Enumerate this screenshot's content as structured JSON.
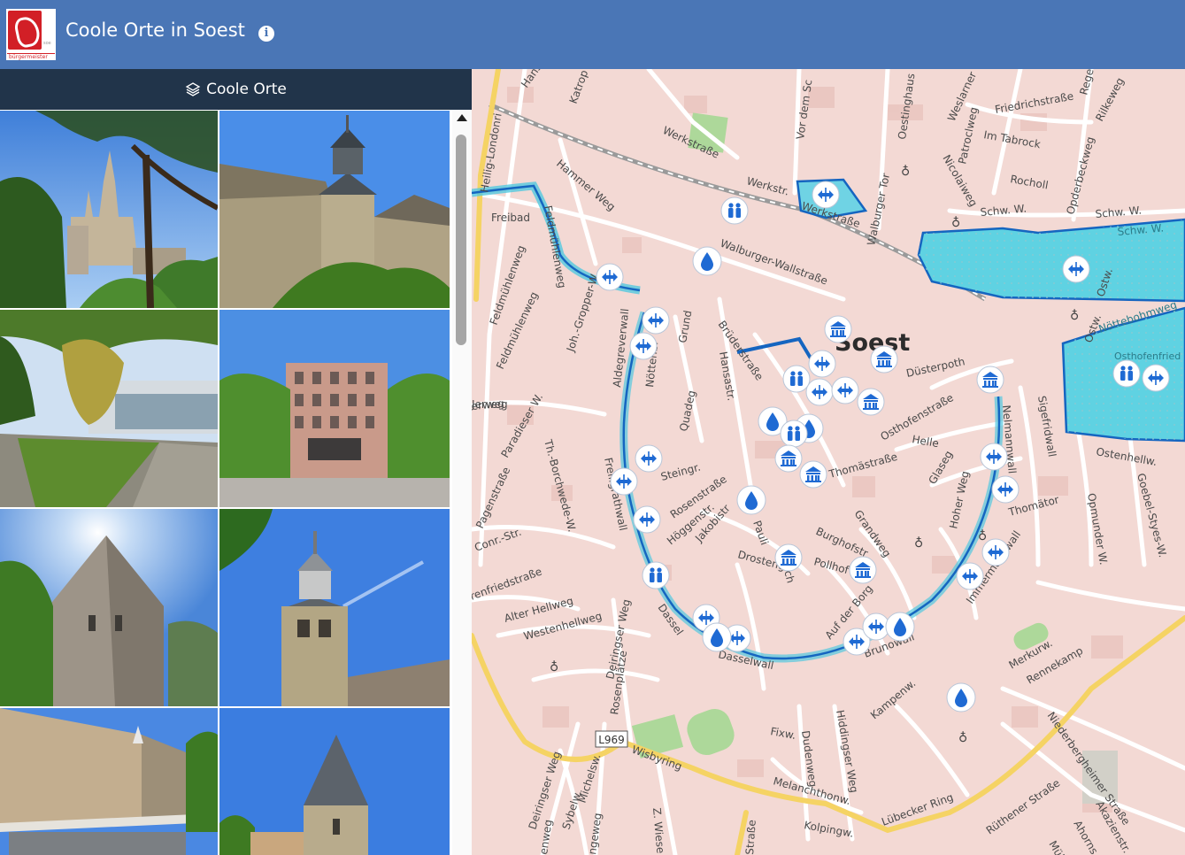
{
  "header": {
    "logo_text": "bürgermeister",
    "logo_side": "soe",
    "title": "Coole Orte in Soest",
    "info_icon": "info-icon"
  },
  "panel": {
    "tab_label": "Coole Orte",
    "tab_icon": "layers-icon"
  },
  "map": {
    "city_label": "Soest",
    "road_badge": "L969",
    "streets": [
      "Hansa",
      "Katrop",
      "Werkstraße",
      "Werkstr.",
      "Werkstraße",
      "Hammer Weg",
      "Feldmühlenweg",
      "Feldmühlenweg",
      "Joh.-Gropper-W.",
      "Vor dem Sc",
      "Oestinghaus",
      "Weslarner",
      "Friedrichstraße",
      "Im Tabrock",
      "Patroclweg",
      "Nicolaiweg",
      "Rocholl",
      "Regenh",
      "Opderbeckweg",
      "Rilkeweg",
      "Schw. W.",
      "Schw. W.",
      "Schw. W.",
      "Walburger Tor",
      "Walburger-Wallstraße",
      "Grund",
      "Brüderstraße",
      "Hansastr.",
      "Aldegreverwall",
      "Nöttenbr",
      "Quadeg",
      "Freiligrathwall",
      "Paradieser W.",
      "Th.-Borchwede-W.",
      "Pagenstraße",
      "Conr.-Str.",
      "erweg",
      "Steingr.",
      "Rosenstraße",
      "Höggenstr.",
      "Jakobistr",
      "Pauli",
      "Drosteng.",
      "Ulrich",
      "Burghofstr",
      "Grandweg",
      "Pollhof",
      "Auf der Borg",
      "Brunowall",
      "Thomästraße",
      "Osthofenstraße",
      "Düsterpoth",
      "Helle",
      "Glaseg",
      "Hoher Weg",
      "Nelmannwall",
      "Sigefridwall",
      "Thomätor",
      "Opmunder W.",
      "Immermannwall",
      "Ostw.",
      "Nöttebohmweg",
      "Osthofenfried",
      "Ostenhellw.",
      "Goebel-Styes-W.",
      "Merkurw.",
      "Rennekamp",
      "Niederbergheimer Straße",
      "Rüthener Straße",
      "Akazienstr.",
      "Ahorns",
      "Mülle",
      "Lübecker Ring",
      "Kolpingw.",
      "Melanchthonw.",
      "Hiddingser Weg",
      "Dudenweg",
      "Fixw.",
      "Kampenw.",
      "Wisbyring",
      "Z. Wiese",
      "Straße",
      "Dasselwall",
      "Dassel",
      "Rosenplätze",
      "Deiringser Weg",
      "Deiringser Weg",
      "Sybelw.",
      "Michelsw.",
      "ngeweg",
      "enweg",
      "Westenhellweg",
      "Alter Hellweg",
      "renfriedstraße",
      "Feldmühlenweg",
      "Jerweg",
      "Heilig-Londonri",
      "Freibad",
      "Ostw."
    ]
  }
}
